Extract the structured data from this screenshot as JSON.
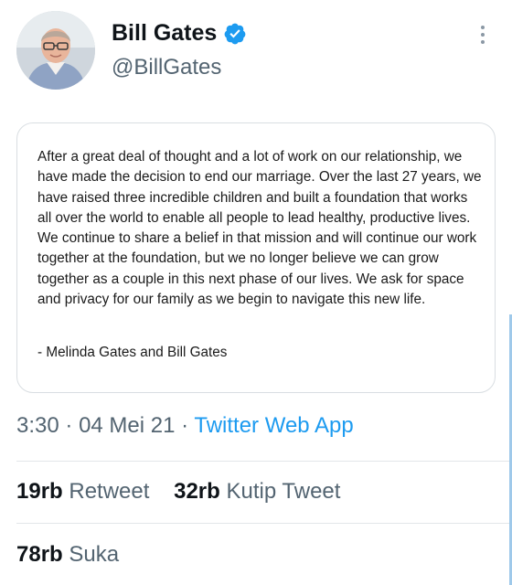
{
  "author": {
    "display_name": "Bill Gates",
    "handle": "@BillGates",
    "verified": true,
    "avatar_icon": "user-avatar",
    "verified_icon": "verified-badge-icon"
  },
  "more_icon": "more-vertical-icon",
  "statement": {
    "text": "After a great deal of thought and a lot of work on our relationship, we have made the decision to end our marriage. Over the last 27 years, we have raised three incredible children and built a foundation that works all over the world to enable all people to lead healthy, productive lives. We continue to share a belief in that mission and will continue our work together at the foundation, but we no longer believe we can grow together as a couple in this next phase of our lives. We ask for space and privacy for our family as we begin to navigate this new life.",
    "signature": "- Melinda Gates and Bill Gates"
  },
  "meta": {
    "time": "3:30",
    "date": "04 Mei 21",
    "separator": "·",
    "source": "Twitter Web App"
  },
  "stats": {
    "retweets": {
      "count": "19rb",
      "label": "Retweet"
    },
    "quotes": {
      "count": "32rb",
      "label": "Kutip Tweet"
    },
    "likes": {
      "count": "78rb",
      "label": "Suka"
    }
  },
  "colors": {
    "accent": "#1d9bf0",
    "text": "#0f1419",
    "secondary": "#536471",
    "border": "#d9dee2"
  }
}
